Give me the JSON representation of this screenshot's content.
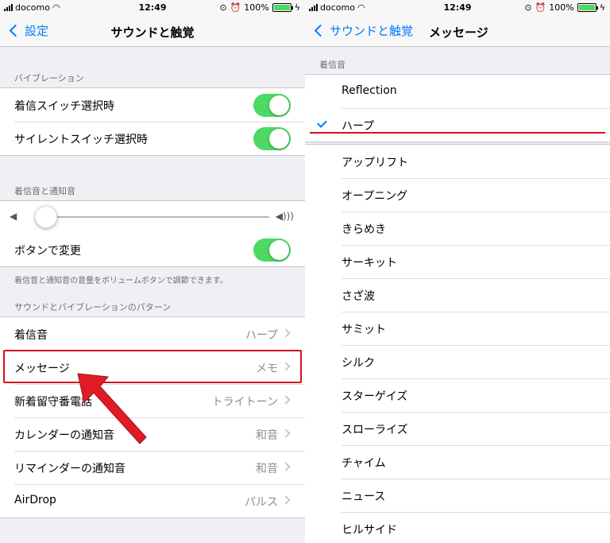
{
  "left": {
    "status": {
      "carrier": "docomo",
      "time": "12:49",
      "battery": "100%"
    },
    "nav": {
      "back": "設定",
      "title": "サウンドと触覚"
    },
    "vibration_header": "バイブレーション",
    "vibration_rows": [
      {
        "label": "着信スイッチ選択時"
      },
      {
        "label": "サイレントスイッチ選択時"
      }
    ],
    "ringer_header": "着信音と通知音",
    "change_with_buttons": "ボタンで変更",
    "footnote": "着信音と通知音の音量をボリュームボタンで調節できます。",
    "patterns_header": "サウンドとバイブレーションのパターン",
    "pattern_rows": [
      {
        "label": "着信音",
        "value": "ハープ"
      },
      {
        "label": "メッセージ",
        "value": "メモ"
      },
      {
        "label": "新着留守番電話",
        "value": "トライトーン"
      },
      {
        "label": "カレンダーの通知音",
        "value": "和音"
      },
      {
        "label": "リマインダーの通知音",
        "value": "和音"
      },
      {
        "label": "AirDrop",
        "value": "パルス"
      }
    ]
  },
  "right": {
    "status": {
      "carrier": "docomo",
      "time": "12:49",
      "battery": "100%"
    },
    "nav": {
      "back": "サウンドと触覚",
      "title": "メッセージ"
    },
    "header": "着信音",
    "top_tones": [
      "Reflection",
      "ハープ"
    ],
    "tones": [
      "アップリフト",
      "オープニング",
      "きらめき",
      "サーキット",
      "さざ波",
      "サミット",
      "シルク",
      "スターゲイズ",
      "スローライズ",
      "チャイム",
      "ニュース",
      "ヒルサイド"
    ]
  }
}
